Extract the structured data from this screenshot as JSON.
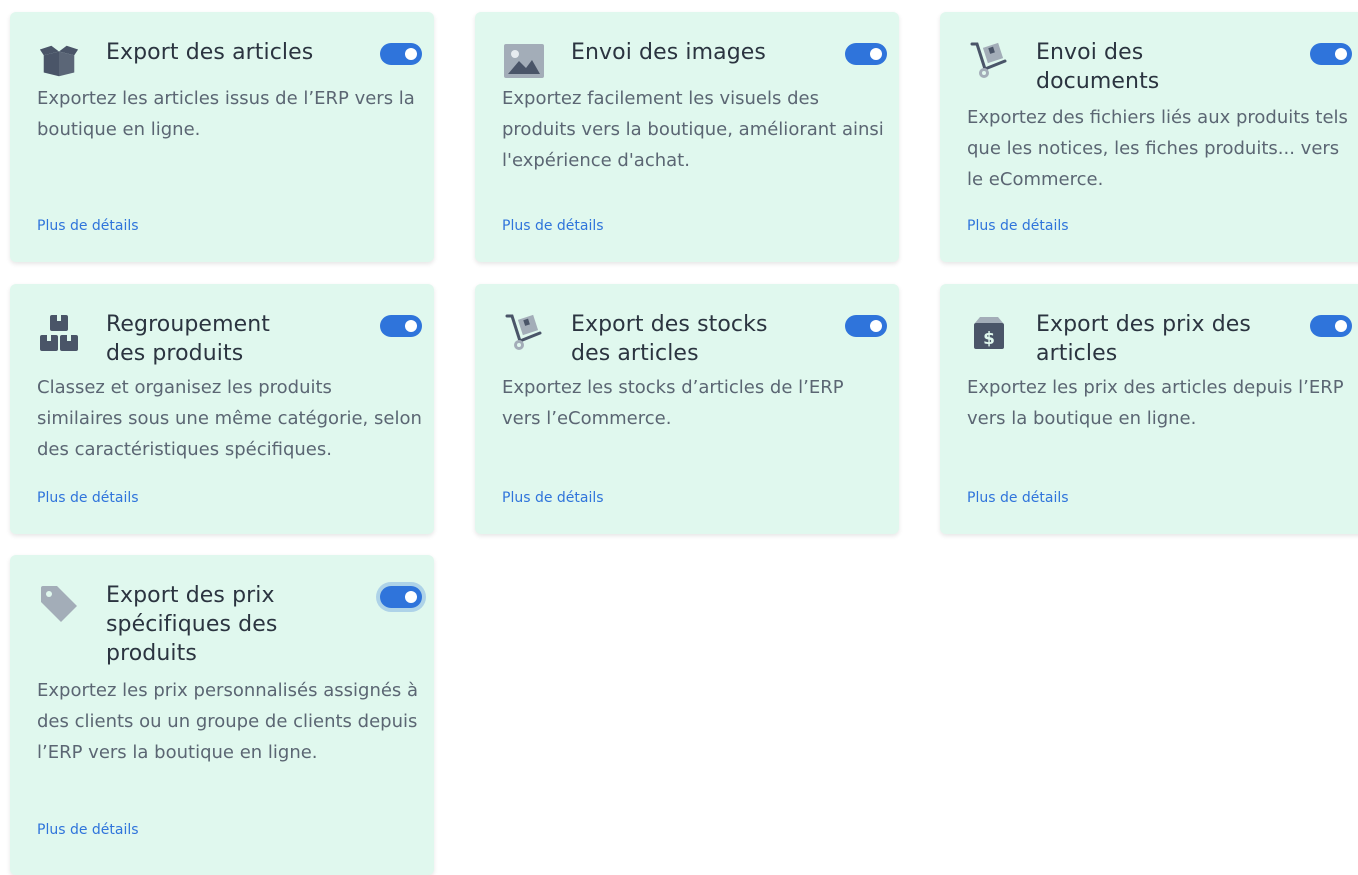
{
  "cards": [
    {
      "title": "Export des articles",
      "icon": "box-open-icon",
      "enabled": true,
      "description": "Exportez les articles issus de l’ERP vers la boutique en ligne.",
      "link": "Plus de détails"
    },
    {
      "title": "Envoi des images",
      "icon": "image-icon",
      "enabled": true,
      "description": "Exportez facilement les visuels des produits vers la boutique, améliorant ainsi l'expérience d'achat.",
      "link": "Plus de détails"
    },
    {
      "title": "Envoi des documents",
      "icon": "hand-truck-icon",
      "enabled": true,
      "description": "Exportez des fichiers liés aux produits tels que les notices, les fiches produits... vers le eCommerce.",
      "link": "Plus de détails"
    },
    {
      "title": "Regroupement des produits",
      "icon": "boxes-icon",
      "enabled": true,
      "description": "Classez et organisez les produits similaires sous une même catégorie, selon des caractéristiques spécifiques.",
      "link": "Plus de détails"
    },
    {
      "title": "Export des stocks des articles",
      "icon": "hand-truck-icon",
      "enabled": true,
      "description": "Exportez les stocks d’articles de l’ERP vers l’eCommerce.",
      "link": "Plus de détails"
    },
    {
      "title": "Export des prix des articles",
      "icon": "dollar-box-icon",
      "enabled": true,
      "description": "Exportez les prix des articles depuis l’ERP vers la boutique en ligne.",
      "link": "Plus de détails"
    },
    {
      "title": "Export des prix spécifiques des produits",
      "icon": "tag-icon",
      "enabled": true,
      "description": "Exportez les prix personnalisés assignés à des clients ou un groupe de clients depuis l’ERP vers la boutique en ligne.",
      "link": "Plus de détails"
    }
  ],
  "colors": {
    "card_bg": "#e0f8ee",
    "accent": "#2f74db",
    "title": "#2b3440",
    "text": "#5b6673",
    "icon": "#4a5568"
  }
}
